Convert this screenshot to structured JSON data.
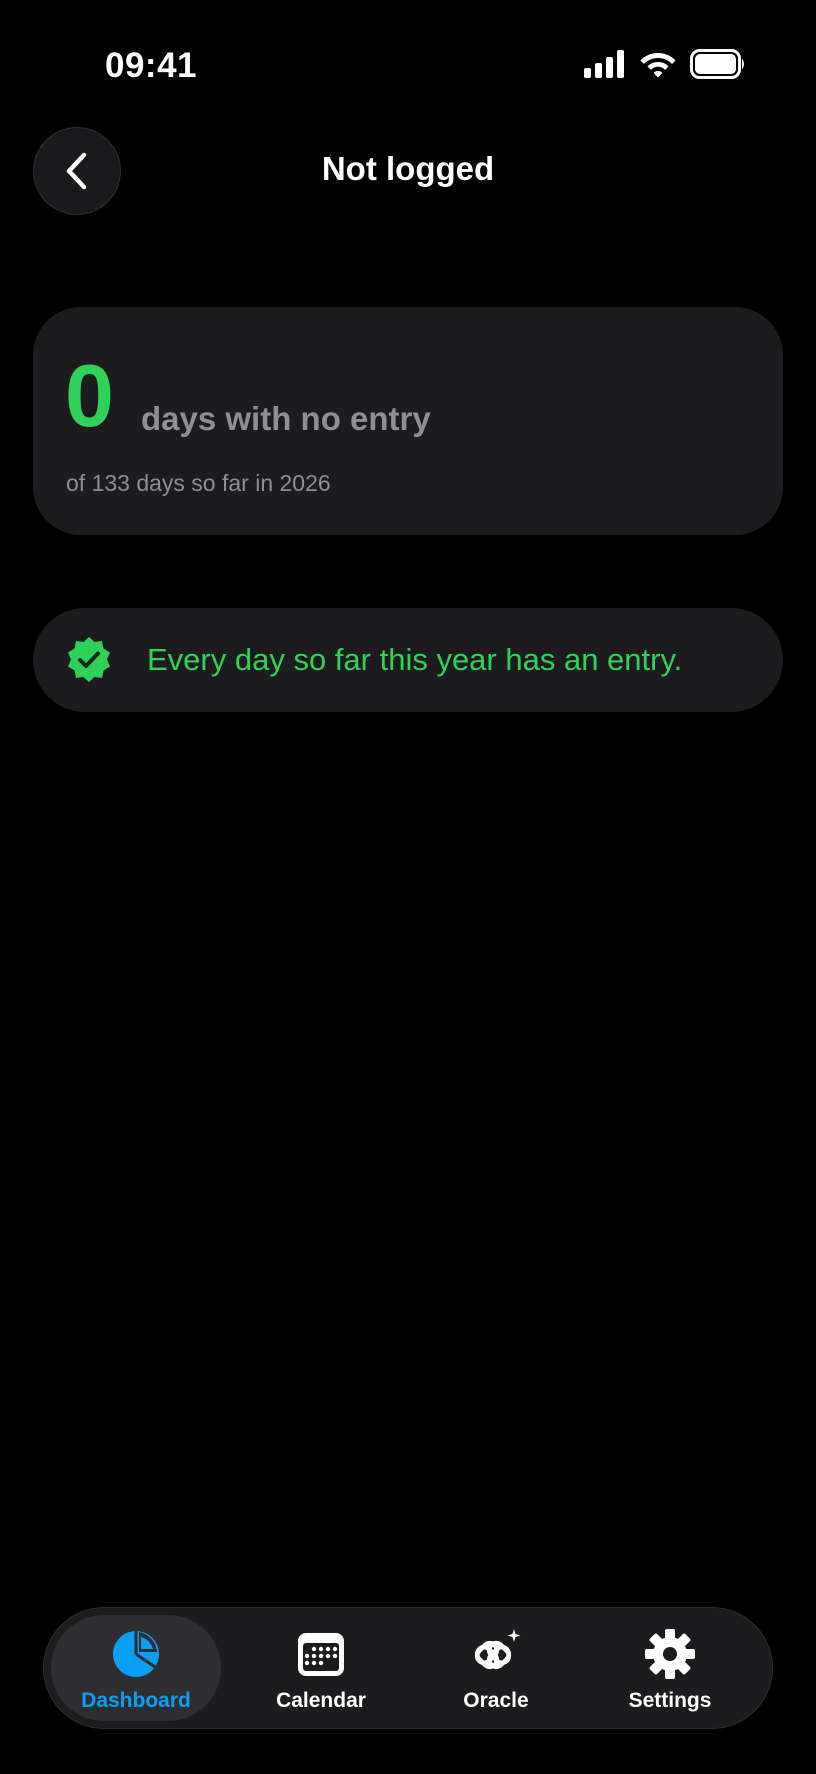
{
  "status_bar": {
    "time": "09:41"
  },
  "header": {
    "title": "Not logged"
  },
  "summary": {
    "count": "0",
    "label": "days with no entry",
    "subtitle": "of 133 days so far in 2026"
  },
  "banner": {
    "text": "Every day so far this year has an entry."
  },
  "tabs": [
    {
      "label": "Dashboard",
      "icon": "pie-chart-icon",
      "active": true
    },
    {
      "label": "Calendar",
      "icon": "calendar-icon",
      "active": false
    },
    {
      "label": "Oracle",
      "icon": "oracle-link-icon",
      "active": false
    },
    {
      "label": "Settings",
      "icon": "gear-icon",
      "active": false
    }
  ],
  "colors": {
    "accent_green": "#30d158",
    "accent_blue": "#0a9ff5",
    "card_bg": "#1c1c1e",
    "secondary_text": "#8e8e93"
  }
}
